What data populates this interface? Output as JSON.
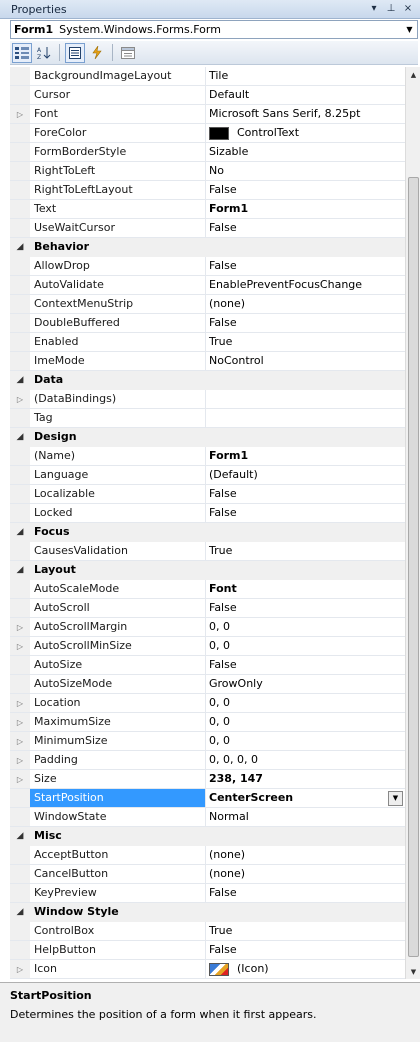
{
  "window": {
    "title": "Properties",
    "pin_glyph": "▾ ⊥ ×"
  },
  "selector": {
    "object_name": "Form1",
    "object_type": "System.Windows.Forms.Form"
  },
  "toolbar": {
    "buttons": [
      "categorized-icon",
      "alphabetical-icon",
      "properties-icon",
      "events-icon",
      "property-pages-icon"
    ]
  },
  "grid": {
    "rows": [
      {
        "kind": "prop",
        "name": "BackgroundImageLayout",
        "value": "Tile",
        "bold": false,
        "expand": false
      },
      {
        "kind": "prop",
        "name": "Cursor",
        "value": "Default",
        "bold": false,
        "expand": false
      },
      {
        "kind": "prop",
        "name": "Font",
        "value": "Microsoft Sans Serif, 8.25pt",
        "bold": false,
        "expand": true
      },
      {
        "kind": "prop",
        "name": "ForeColor",
        "value": "ControlText",
        "bold": false,
        "expand": false,
        "swatch": "#000000"
      },
      {
        "kind": "prop",
        "name": "FormBorderStyle",
        "value": "Sizable",
        "bold": false,
        "expand": false
      },
      {
        "kind": "prop",
        "name": "RightToLeft",
        "value": "No",
        "bold": false,
        "expand": false
      },
      {
        "kind": "prop",
        "name": "RightToLeftLayout",
        "value": "False",
        "bold": false,
        "expand": false
      },
      {
        "kind": "prop",
        "name": "Text",
        "value": "Form1",
        "bold": true,
        "expand": false
      },
      {
        "kind": "prop",
        "name": "UseWaitCursor",
        "value": "False",
        "bold": false,
        "expand": false
      },
      {
        "kind": "cat",
        "name": "Behavior"
      },
      {
        "kind": "prop",
        "name": "AllowDrop",
        "value": "False",
        "bold": false,
        "expand": false
      },
      {
        "kind": "prop",
        "name": "AutoValidate",
        "value": "EnablePreventFocusChange",
        "bold": false,
        "expand": false
      },
      {
        "kind": "prop",
        "name": "ContextMenuStrip",
        "value": "(none)",
        "bold": false,
        "expand": false
      },
      {
        "kind": "prop",
        "name": "DoubleBuffered",
        "value": "False",
        "bold": false,
        "expand": false
      },
      {
        "kind": "prop",
        "name": "Enabled",
        "value": "True",
        "bold": false,
        "expand": false
      },
      {
        "kind": "prop",
        "name": "ImeMode",
        "value": "NoControl",
        "bold": false,
        "expand": false
      },
      {
        "kind": "cat",
        "name": "Data"
      },
      {
        "kind": "prop",
        "name": "(DataBindings)",
        "value": "",
        "bold": false,
        "expand": true
      },
      {
        "kind": "prop",
        "name": "Tag",
        "value": "",
        "bold": false,
        "expand": false
      },
      {
        "kind": "cat",
        "name": "Design"
      },
      {
        "kind": "prop",
        "name": "(Name)",
        "value": "Form1",
        "bold": true,
        "expand": false
      },
      {
        "kind": "prop",
        "name": "Language",
        "value": "(Default)",
        "bold": false,
        "expand": false
      },
      {
        "kind": "prop",
        "name": "Localizable",
        "value": "False",
        "bold": false,
        "expand": false
      },
      {
        "kind": "prop",
        "name": "Locked",
        "value": "False",
        "bold": false,
        "expand": false
      },
      {
        "kind": "cat",
        "name": "Focus"
      },
      {
        "kind": "prop",
        "name": "CausesValidation",
        "value": "True",
        "bold": false,
        "expand": false
      },
      {
        "kind": "cat",
        "name": "Layout"
      },
      {
        "kind": "prop",
        "name": "AutoScaleMode",
        "value": "Font",
        "bold": true,
        "expand": false
      },
      {
        "kind": "prop",
        "name": "AutoScroll",
        "value": "False",
        "bold": false,
        "expand": false
      },
      {
        "kind": "prop",
        "name": "AutoScrollMargin",
        "value": "0, 0",
        "bold": false,
        "expand": true
      },
      {
        "kind": "prop",
        "name": "AutoScrollMinSize",
        "value": "0, 0",
        "bold": false,
        "expand": true
      },
      {
        "kind": "prop",
        "name": "AutoSize",
        "value": "False",
        "bold": false,
        "expand": false
      },
      {
        "kind": "prop",
        "name": "AutoSizeMode",
        "value": "GrowOnly",
        "bold": false,
        "expand": false
      },
      {
        "kind": "prop",
        "name": "Location",
        "value": "0, 0",
        "bold": false,
        "expand": true
      },
      {
        "kind": "prop",
        "name": "MaximumSize",
        "value": "0, 0",
        "bold": false,
        "expand": true
      },
      {
        "kind": "prop",
        "name": "MinimumSize",
        "value": "0, 0",
        "bold": false,
        "expand": true
      },
      {
        "kind": "prop",
        "name": "Padding",
        "value": "0, 0, 0, 0",
        "bold": false,
        "expand": true
      },
      {
        "kind": "prop",
        "name": "Size",
        "value": "238, 147",
        "bold": true,
        "expand": true
      },
      {
        "kind": "prop",
        "name": "StartPosition",
        "value": "CenterScreen",
        "bold": true,
        "expand": false,
        "selected": true
      },
      {
        "kind": "prop",
        "name": "WindowState",
        "value": "Normal",
        "bold": false,
        "expand": false
      },
      {
        "kind": "cat",
        "name": "Misc"
      },
      {
        "kind": "prop",
        "name": "AcceptButton",
        "value": "(none)",
        "bold": false,
        "expand": false
      },
      {
        "kind": "prop",
        "name": "CancelButton",
        "value": "(none)",
        "bold": false,
        "expand": false
      },
      {
        "kind": "prop",
        "name": "KeyPreview",
        "value": "False",
        "bold": false,
        "expand": false
      },
      {
        "kind": "cat",
        "name": "Window Style"
      },
      {
        "kind": "prop",
        "name": "ControlBox",
        "value": "True",
        "bold": false,
        "expand": false
      },
      {
        "kind": "prop",
        "name": "HelpButton",
        "value": "False",
        "bold": false,
        "expand": false
      },
      {
        "kind": "prop",
        "name": "Icon",
        "value": "(Icon)",
        "bold": false,
        "expand": true,
        "icon": true
      }
    ]
  },
  "description": {
    "title": "StartPosition",
    "text": "Determines the position of a form when it first appears."
  },
  "colors": {
    "selection": "#3399ff",
    "category_bg": "#f0f0f0"
  }
}
